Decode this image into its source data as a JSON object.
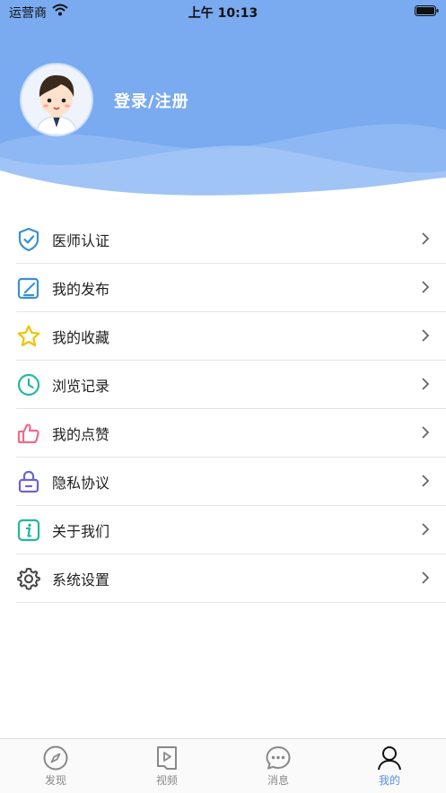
{
  "status_bar": {
    "carrier": "运营商",
    "time": "上午 10:13"
  },
  "profile": {
    "login_label": "登录/注册"
  },
  "menu": {
    "items": [
      {
        "label": "医师认证",
        "icon": "shield-check-icon",
        "color": "#3b8fd6"
      },
      {
        "label": "我的发布",
        "icon": "edit-icon",
        "color": "#3b8fd6"
      },
      {
        "label": "我的收藏",
        "icon": "star-icon",
        "color": "#f2c200"
      },
      {
        "label": "浏览记录",
        "icon": "clock-icon",
        "color": "#22b8a0"
      },
      {
        "label": "我的点赞",
        "icon": "thumbs-up-icon",
        "color": "#ef6a8a"
      },
      {
        "label": "隐私协议",
        "icon": "lock-icon",
        "color": "#6a62d8"
      },
      {
        "label": "关于我们",
        "icon": "info-icon",
        "color": "#22b8a0"
      },
      {
        "label": "系统设置",
        "icon": "gear-icon",
        "color": "#444444"
      }
    ]
  },
  "tabbar": {
    "tabs": [
      {
        "label": "发现",
        "icon": "compass-icon"
      },
      {
        "label": "视频",
        "icon": "video-icon"
      },
      {
        "label": "消息",
        "icon": "message-icon"
      },
      {
        "label": "我的",
        "icon": "user-icon",
        "active": true
      }
    ]
  },
  "colors": {
    "header": "#7aaaf0",
    "accent": "#5b8fe6"
  }
}
